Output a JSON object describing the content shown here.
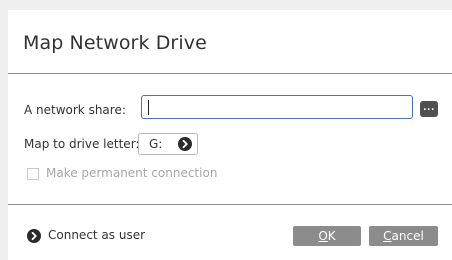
{
  "dialog": {
    "title": "Map Network Drive",
    "network_share": {
      "label": "A network share:",
      "value": "",
      "browse_label": "..."
    },
    "drive_letter": {
      "label": "Map to drive letter:",
      "selected": "G:"
    },
    "permanent": {
      "label": "Make permanent connection",
      "checked": false,
      "enabled": false
    },
    "connect_as_user": {
      "label": "Connect as user"
    },
    "buttons": {
      "ok_label": "OK",
      "cancel_label": "Cancel"
    },
    "colors": {
      "accent_border": "#4a73b6",
      "button_bg": "#8c8c8c",
      "icon_bg": "#2b2b2b"
    }
  }
}
